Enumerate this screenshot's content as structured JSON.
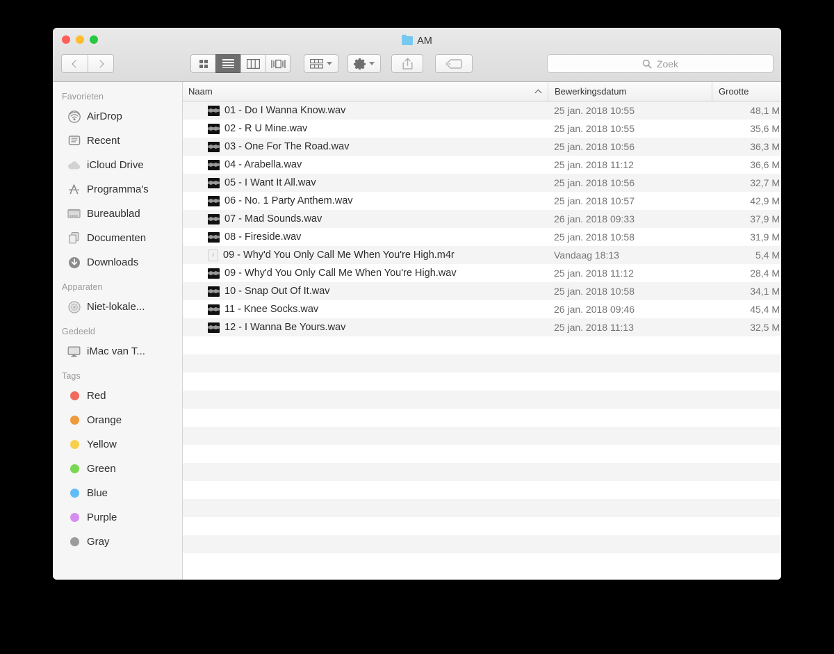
{
  "window": {
    "title": "AM",
    "folder_icon": "folder-icon",
    "traffic_lights": {
      "close": "close-button",
      "minimize": "minimize-button",
      "maximize": "maximize-button"
    },
    "colors": {
      "close": "#ff5f57",
      "minimize": "#febc2e",
      "maximize": "#28c840",
      "folder": "#76c8f0"
    }
  },
  "toolbar": {
    "back_icon": "chevron-left-icon",
    "forward_icon": "chevron-right-icon",
    "view_modes": [
      {
        "name": "icon-view",
        "icon": "grid-icon",
        "active": false
      },
      {
        "name": "list-view",
        "icon": "list-icon",
        "active": true
      },
      {
        "name": "column-view",
        "icon": "columns-icon",
        "active": false
      },
      {
        "name": "gallery-view",
        "icon": "coverflow-icon",
        "active": false
      }
    ],
    "arrange_icon": "arrange-grid-icon",
    "action_icon": "gear-icon",
    "share_icon": "share-icon",
    "tag_icon": "tag-icon"
  },
  "search": {
    "placeholder": "Zoek",
    "value": "",
    "icon": "search-icon"
  },
  "sidebar": {
    "sections": [
      {
        "header": "Favorieten",
        "items": [
          {
            "label": "AirDrop",
            "icon": "airdrop-icon"
          },
          {
            "label": "Recent",
            "icon": "recent-clock-icon"
          },
          {
            "label": "iCloud Drive",
            "icon": "icloud-icon"
          },
          {
            "label": "Programma's",
            "icon": "applications-icon"
          },
          {
            "label": "Bureaublad",
            "icon": "desktop-icon"
          },
          {
            "label": "Documenten",
            "icon": "documents-icon"
          },
          {
            "label": "Downloads",
            "icon": "downloads-icon"
          }
        ]
      },
      {
        "header": "Apparaten",
        "items": [
          {
            "label": "Niet-lokale...",
            "icon": "disc-icon"
          }
        ]
      },
      {
        "header": "Gedeeld",
        "items": [
          {
            "label": "iMac van T...",
            "icon": "imac-icon"
          }
        ]
      },
      {
        "header": "Tags",
        "items": [
          {
            "label": "Red",
            "icon": "tag-dot-icon",
            "color": "#ee6b5e"
          },
          {
            "label": "Orange",
            "icon": "tag-dot-icon",
            "color": "#ef9a3c"
          },
          {
            "label": "Yellow",
            "icon": "tag-dot-icon",
            "color": "#f7d04e"
          },
          {
            "label": "Green",
            "icon": "tag-dot-icon",
            "color": "#78d84f"
          },
          {
            "label": "Blue",
            "icon": "tag-dot-icon",
            "color": "#61bdf5"
          },
          {
            "label": "Purple",
            "icon": "tag-dot-icon",
            "color": "#d58ef0"
          },
          {
            "label": "Gray",
            "icon": "tag-dot-icon",
            "color": "#9b9b9b"
          }
        ]
      }
    ]
  },
  "filelist": {
    "columns": [
      {
        "key": "naam",
        "label": "Naam",
        "sorted": true,
        "sort_direction": "ascending"
      },
      {
        "key": "datum",
        "label": "Bewerkingsdatum",
        "sorted": false
      },
      {
        "key": "grootte",
        "label": "Grootte",
        "sorted": false
      }
    ],
    "rows": [
      {
        "naam": "01 - Do I Wanna Know.wav",
        "icon": "wav-file-icon",
        "datum": "25 jan. 2018 10:55",
        "grootte": "48,1 M"
      },
      {
        "naam": "02 - R U Mine.wav",
        "icon": "wav-file-icon",
        "datum": "25 jan. 2018 10:55",
        "grootte": "35,6 M"
      },
      {
        "naam": "03 - One For The Road.wav",
        "icon": "wav-file-icon",
        "datum": "25 jan. 2018 10:56",
        "grootte": "36,3 M"
      },
      {
        "naam": "04 - Arabella.wav",
        "icon": "wav-file-icon",
        "datum": "25 jan. 2018 11:12",
        "grootte": "36,6 M"
      },
      {
        "naam": "05 - I Want It All.wav",
        "icon": "wav-file-icon",
        "datum": "25 jan. 2018 10:56",
        "grootte": "32,7 M"
      },
      {
        "naam": "06 - No. 1 Party Anthem.wav",
        "icon": "wav-file-icon",
        "datum": "25 jan. 2018 10:57",
        "grootte": "42,9 M"
      },
      {
        "naam": "07 - Mad Sounds.wav",
        "icon": "wav-file-icon",
        "datum": "26 jan. 2018 09:33",
        "grootte": "37,9 M"
      },
      {
        "naam": "08 - Fireside.wav",
        "icon": "wav-file-icon",
        "datum": "25 jan. 2018 10:58",
        "grootte": "31,9 M"
      },
      {
        "naam": "09 - Why'd You Only Call Me When You're High.m4r",
        "icon": "m4r-file-icon",
        "datum": "Vandaag 18:13",
        "grootte": "5,4 M"
      },
      {
        "naam": "09 - Why'd You Only Call Me When You're High.wav",
        "icon": "wav-file-icon",
        "datum": "25 jan. 2018 11:12",
        "grootte": "28,4 M"
      },
      {
        "naam": "10 - Snap Out Of It.wav",
        "icon": "wav-file-icon",
        "datum": "25 jan. 2018 10:58",
        "grootte": "34,1 M"
      },
      {
        "naam": "11 - Knee Socks.wav",
        "icon": "wav-file-icon",
        "datum": "26 jan. 2018 09:46",
        "grootte": "45,4 M"
      },
      {
        "naam": "12 - I Wanna Be Yours.wav",
        "icon": "wav-file-icon",
        "datum": "25 jan. 2018 11:13",
        "grootte": "32,5 M"
      }
    ],
    "empty_row_count": 13
  }
}
